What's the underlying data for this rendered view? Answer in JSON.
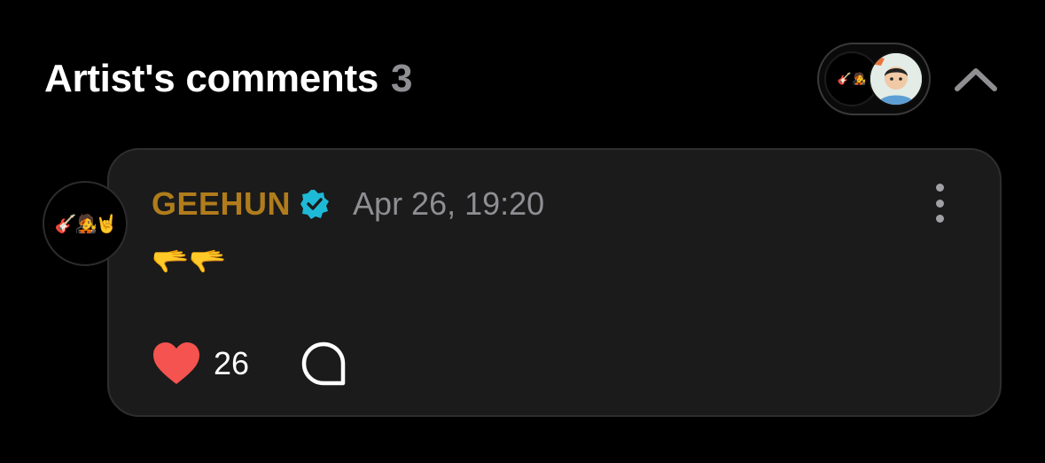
{
  "header": {
    "title": "Artist's comments",
    "count": "3"
  },
  "avatar_stack": {
    "first_avatar_emoji": "🎸🧑‍🎤"
  },
  "comment": {
    "avatar_emoji": "🎸🧑‍🎤🤘",
    "author": "GEEHUN",
    "timestamp": "Apr 26, 19:20",
    "body": "🫳🫳",
    "like_count": "26"
  },
  "icons": {
    "verified": "verified-badge-icon",
    "more": "more-vertical-icon",
    "collapse": "chevron-up-icon",
    "like": "heart-icon",
    "reply": "comment-bubble-icon"
  },
  "colors": {
    "background": "#000000",
    "card": "#1b1b1b",
    "author": "#b07c1c",
    "verified": "#1fb9d8",
    "heart": "#f4534f",
    "muted": "#8e8e93"
  }
}
